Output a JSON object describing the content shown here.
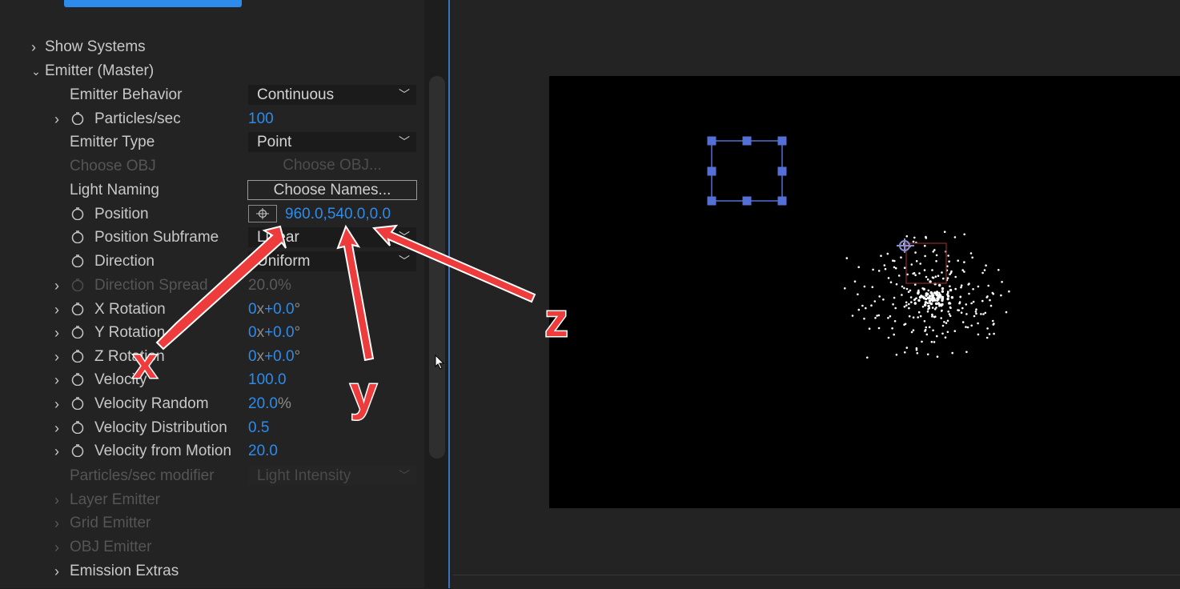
{
  "effect_controls": {
    "rows": [
      {
        "label": "Show Systems"
      },
      {
        "label": "Emitter (Master)"
      },
      {
        "label": "Emitter Behavior",
        "value": "Continuous"
      },
      {
        "label": "Particles/sec",
        "value": "100"
      },
      {
        "label": "Emitter Type",
        "value": "Point"
      },
      {
        "label": "Choose OBJ",
        "value": "Choose OBJ..."
      },
      {
        "label": "Light Naming",
        "value": "Choose Names..."
      },
      {
        "label": "Position",
        "value": "960.0,540.0,0.0"
      },
      {
        "label": "Position Subframe",
        "value": "Linear"
      },
      {
        "label": "Direction",
        "value": "Uniform"
      },
      {
        "label": "Direction Spread",
        "value": "20.0",
        "unit": "%"
      },
      {
        "label": "X Rotation",
        "value": "0",
        "unit_x": "x",
        "value2": "+0.0",
        "unit_deg": "°"
      },
      {
        "label": "Y Rotation",
        "value": "0",
        "unit_x": "x",
        "value2": "+0.0",
        "unit_deg": "°"
      },
      {
        "label": "Z Rotation",
        "value": "0",
        "unit_x": "x",
        "value2": "+0.0",
        "unit_deg": "°"
      },
      {
        "label": "Velocity",
        "value": "100.0"
      },
      {
        "label": "Velocity Random",
        "value": "20.0",
        "unit": "%"
      },
      {
        "label": "Velocity Distribution",
        "value": "0.5"
      },
      {
        "label": "Velocity from Motion",
        "value": "20.0"
      },
      {
        "label": "Particles/sec modifier",
        "value": "Light Intensity"
      },
      {
        "label": "Layer Emitter"
      },
      {
        "label": "Grid Emitter"
      },
      {
        "label": "OBJ Emitter"
      },
      {
        "label": "Emission Extras"
      }
    ]
  },
  "annotations": {
    "x_label": "x",
    "y_label": "y",
    "z_label": "z",
    "arrow_color": "#ee3b3b"
  },
  "colors": {
    "accent_blue": "#2d8ceb",
    "selection_box": "#5470d6",
    "emitter_box": "#8c2b2b"
  }
}
